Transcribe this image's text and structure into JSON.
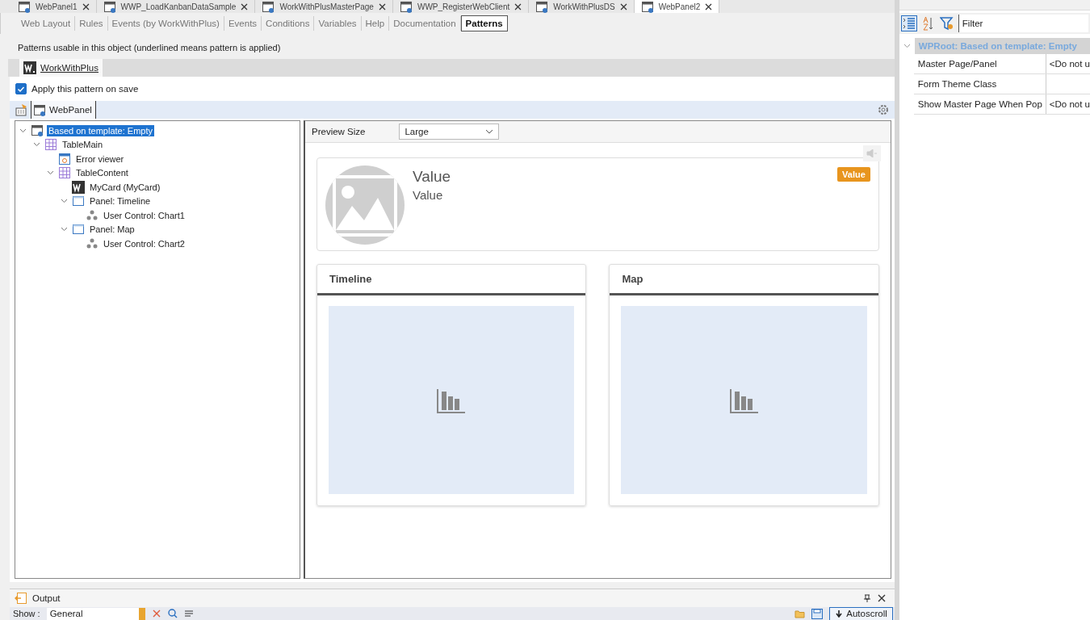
{
  "document_tabs": [
    {
      "label": "WebPanel1",
      "selected": false
    },
    {
      "label": "WWP_LoadKanbanDataSample",
      "selected": false
    },
    {
      "label": "WorkWithPlusMasterPage",
      "selected": false
    },
    {
      "label": "WWP_RegisterWebClient",
      "selected": false
    },
    {
      "label": "WorkWithPlusDS",
      "selected": false
    },
    {
      "label": "WebPanel2",
      "selected": true
    }
  ],
  "section_tabs": [
    {
      "label": "Web Layout",
      "selected": false
    },
    {
      "label": "Rules",
      "selected": false
    },
    {
      "label": "Events (by WorkWithPlus)",
      "selected": false
    },
    {
      "label": "Events",
      "selected": false
    },
    {
      "label": "Conditions",
      "selected": false
    },
    {
      "label": "Variables",
      "selected": false
    },
    {
      "label": "Help",
      "selected": false
    },
    {
      "label": "Documentation",
      "selected": false
    },
    {
      "label": "Patterns",
      "selected": true
    }
  ],
  "patterns_hint": "Patterns usable in this object (underlined means pattern is applied)",
  "pattern_tabs": [
    {
      "label": "WorkWithPlus",
      "selected": true
    }
  ],
  "apply_on_save": {
    "label": "Apply this pattern on save",
    "checked": true
  },
  "instance_tabs": [
    {
      "label": "WebPanel",
      "selected": true
    }
  ],
  "tree": [
    {
      "label": "Based on template: Empty",
      "kind": "webpanel",
      "selected": true,
      "expanded": true,
      "children": [
        {
          "label": "TableMain",
          "kind": "table",
          "selected": false,
          "expanded": true,
          "children": [
            {
              "label": "Error viewer",
              "kind": "error",
              "selected": false
            },
            {
              "label": "TableContent",
              "kind": "table",
              "selected": false,
              "expanded": true,
              "children": [
                {
                  "label": "MyCard (MyCard)",
                  "kind": "wlogo",
                  "selected": false
                },
                {
                  "label": "Panel: Timeline",
                  "kind": "panel",
                  "selected": false,
                  "expanded": true,
                  "children": [
                    {
                      "label": "User Control: Chart1",
                      "kind": "usercontrol",
                      "selected": false
                    }
                  ]
                },
                {
                  "label": "Panel: Map",
                  "kind": "panel",
                  "selected": false,
                  "expanded": true,
                  "children": [
                    {
                      "label": "User Control: Chart2",
                      "kind": "usercontrol",
                      "selected": false
                    }
                  ]
                }
              ]
            }
          ]
        }
      ]
    }
  ],
  "preview": {
    "size_label": "Preview Size",
    "size_value": "Large",
    "card": {
      "title": "Value",
      "subtitle": "Value",
      "badge": "Value"
    },
    "panels": [
      {
        "title": "Timeline"
      },
      {
        "title": "Map"
      }
    ]
  },
  "output": {
    "title": "Output",
    "show_label": "Show :",
    "show_value": "General",
    "autoscroll": "Autoscroll"
  },
  "properties": {
    "filter_label": "Filter",
    "group": "WPRoot: Based on template: Empty",
    "rows": [
      {
        "name": "Master Page/Panel",
        "value": "<Do not u"
      },
      {
        "name": "Form Theme Class",
        "value": ""
      },
      {
        "name": "Show Master Page When Pop",
        "value": "<Do not u"
      }
    ]
  }
}
